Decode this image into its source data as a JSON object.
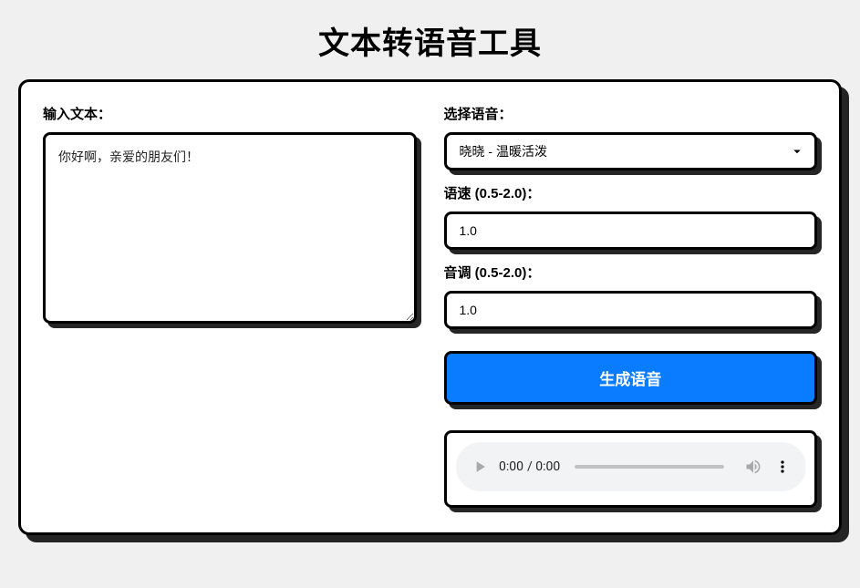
{
  "title": "文本转语音工具",
  "left": {
    "textLabel": "输入文本：",
    "textValue": "你好啊，亲爱的朋友们！"
  },
  "right": {
    "voiceLabel": "选择语音：",
    "voiceSelected": "晓晓 - 温暖活泼",
    "speedLabel": "语速 (0.5-2.0)：",
    "speedValue": "1.0",
    "pitchLabel": "音调 (0.5-2.0)：",
    "pitchValue": "1.0",
    "generateLabel": "生成语音",
    "audioTime": "0:00 / 0:00"
  }
}
